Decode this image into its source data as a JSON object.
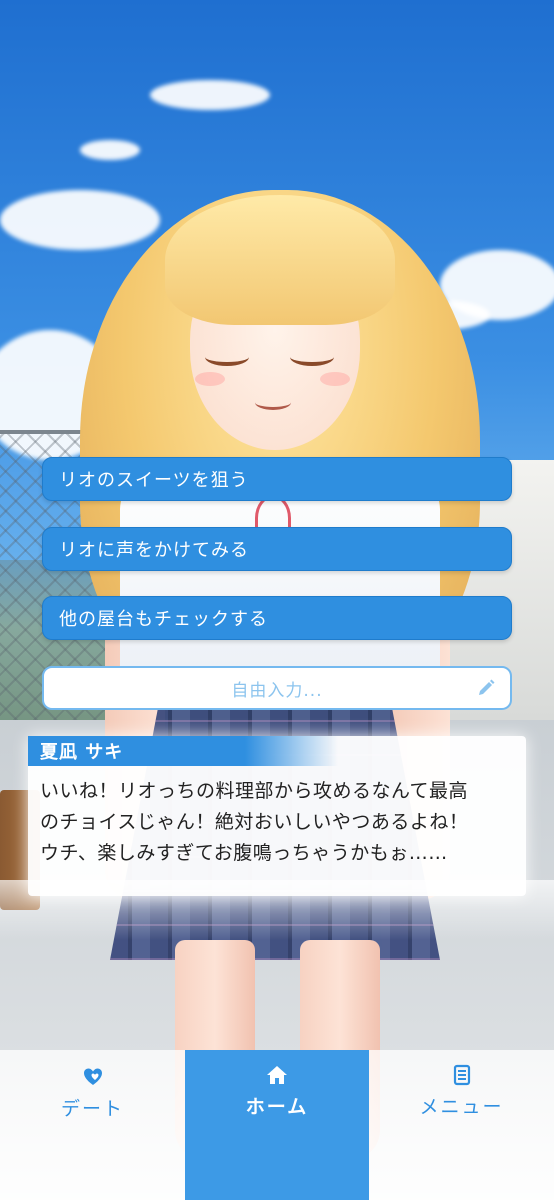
{
  "choices": [
    {
      "label": "リオのスイーツを狙う"
    },
    {
      "label": "リオに声をかけてみる"
    },
    {
      "label": "他の屋台もチェックする"
    }
  ],
  "free_input": {
    "placeholder": "自由入力..."
  },
  "dialog": {
    "speaker": "夏凪 サキ",
    "lines": [
      "いいね！リオっちの料理部から攻めるなんて最高",
      "のチョイスじゃん！絶対おいしいやつあるよね！",
      "ウチ、楽しみすぎてお腹鳴っちゃうかもぉ……"
    ]
  },
  "nav": {
    "items": [
      {
        "label": "デート",
        "icon": "heart-icon"
      },
      {
        "label": "ホーム",
        "icon": "home-icon",
        "active": true
      },
      {
        "label": "メニュー",
        "icon": "menu-list-icon"
      }
    ]
  },
  "colors": {
    "accent": "#2f8fe0",
    "nav_active": "#3d9ae6",
    "input_border": "#74b9ef"
  }
}
